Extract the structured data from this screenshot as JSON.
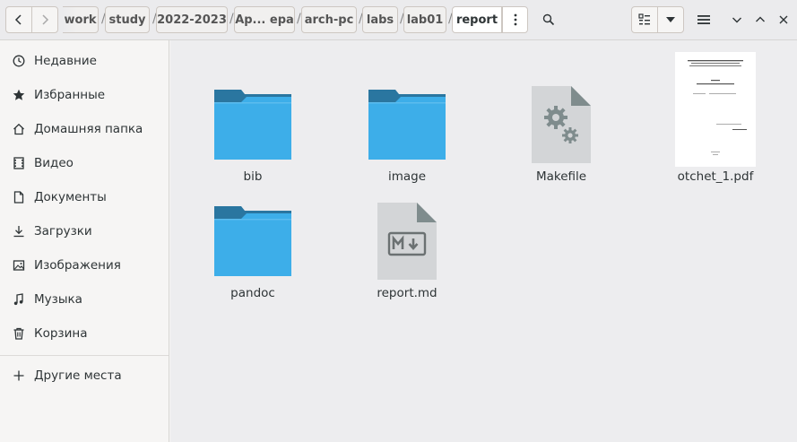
{
  "header": {
    "breadcrumbs": [
      "work",
      "study",
      "2022-2023",
      "Ар... ера",
      "arch-pc",
      "labs",
      "lab01",
      "report"
    ],
    "separator": "/"
  },
  "icons": {
    "back": "chevron-left-icon",
    "forward": "chevron-right-icon",
    "more": "vertical-dots-icon",
    "search": "search-icon",
    "view": "list-view-icon",
    "view_menu": "caret-down-icon",
    "menu": "hamburger-icon",
    "minimize": "chevron-down-icon",
    "maximize": "chevron-up-icon",
    "close": "close-icon"
  },
  "sidebar": {
    "items": [
      {
        "label": "Недавние",
        "icon": "clock-icon"
      },
      {
        "label": "Избранные",
        "icon": "star-icon"
      },
      {
        "label": "Домашняя папка",
        "icon": "home-icon"
      },
      {
        "label": "Видео",
        "icon": "film-icon"
      },
      {
        "label": "Документы",
        "icon": "document-icon"
      },
      {
        "label": "Загрузки",
        "icon": "download-icon"
      },
      {
        "label": "Изображения",
        "icon": "image-icon"
      },
      {
        "label": "Музыка",
        "icon": "music-icon"
      },
      {
        "label": "Корзина",
        "icon": "trash-icon"
      }
    ],
    "other_places": {
      "label": "Другие места",
      "icon": "plus-icon"
    }
  },
  "files": [
    {
      "name": "bib",
      "kind": "folder"
    },
    {
      "name": "image",
      "kind": "folder"
    },
    {
      "name": "Makefile",
      "kind": "makefile"
    },
    {
      "name": "otchet_1.pdf",
      "kind": "pdf"
    },
    {
      "name": "pandoc",
      "kind": "folder"
    },
    {
      "name": "report.md",
      "kind": "markdown"
    }
  ],
  "colors": {
    "folder_front": "#3daee9",
    "folder_back": "#2a76a0",
    "accent_text": "#2e3436"
  }
}
